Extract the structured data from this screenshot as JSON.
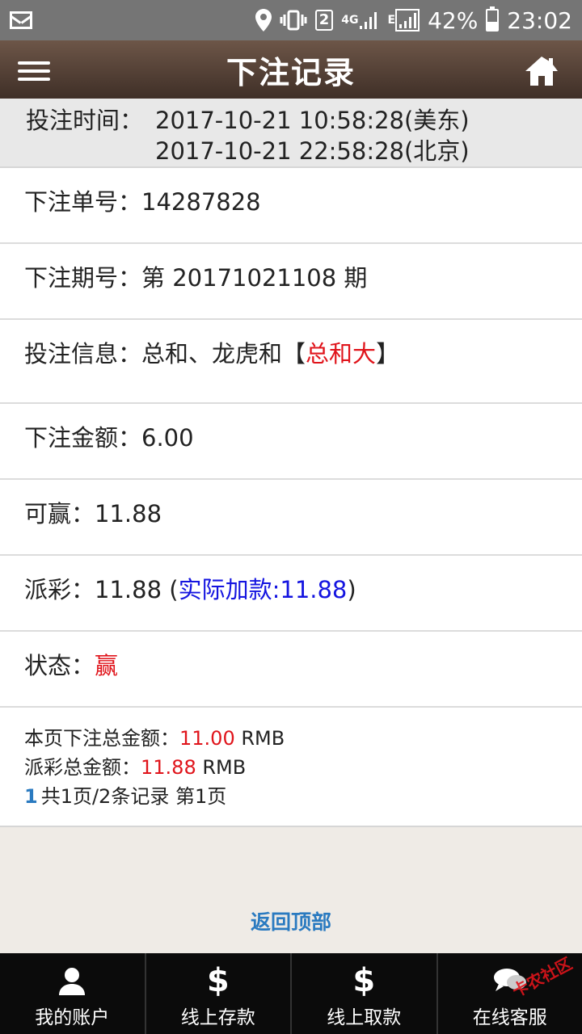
{
  "status_bar": {
    "sim_slot": "2",
    "network": "4G",
    "network_secondary": "E",
    "battery": "42%",
    "time": "23:02"
  },
  "header": {
    "title": "下注记录"
  },
  "bet_time": {
    "label": "投注时间：",
    "us_east": "2017-10-21 10:58:28(美东)",
    "beijing": "2017-10-21 22:58:28(北京)"
  },
  "record": {
    "order_label": "下注单号：",
    "order_value": "14287828",
    "period_label": "下注期号：",
    "period_value": "第 20171021108 期",
    "info_label": "投注信息：",
    "info_value": "总和、龙虎和",
    "info_bracket_open": "【",
    "info_highlight": "总和大",
    "info_bracket_close": "】",
    "amount_label": "下注金额：",
    "amount_value": "6.00",
    "win_label": "可赢：",
    "win_value": "11.88",
    "payout_label": "派彩：",
    "payout_value": "11.88",
    "payout_paren_open": " (",
    "payout_actual": "实际加款:11.88",
    "payout_paren_close": ")",
    "state_label": "状态：",
    "state_value": "赢"
  },
  "summary": {
    "page_total_label": "本页下注总金额：",
    "page_total_value": "11.00",
    "page_total_unit": " RMB",
    "payout_total_label": "派彩总金额：",
    "payout_total_value": "11.88",
    "payout_total_unit": " RMB",
    "page_link": "1",
    "page_info": "共1页/2条记录 第1页"
  },
  "back_to_top": "返回顶部",
  "bottom_nav": [
    {
      "label": "我的账户",
      "icon": "user-icon"
    },
    {
      "label": "线上存款",
      "icon": "dollar-icon"
    },
    {
      "label": "线上取款",
      "icon": "dollar-icon"
    },
    {
      "label": "在线客服",
      "icon": "chat-icon"
    }
  ],
  "watermark": "卡农社区",
  "colors": {
    "highlight_red": "#e0141b",
    "highlight_blue": "#1414e0",
    "link_blue": "#2a7ac0"
  }
}
